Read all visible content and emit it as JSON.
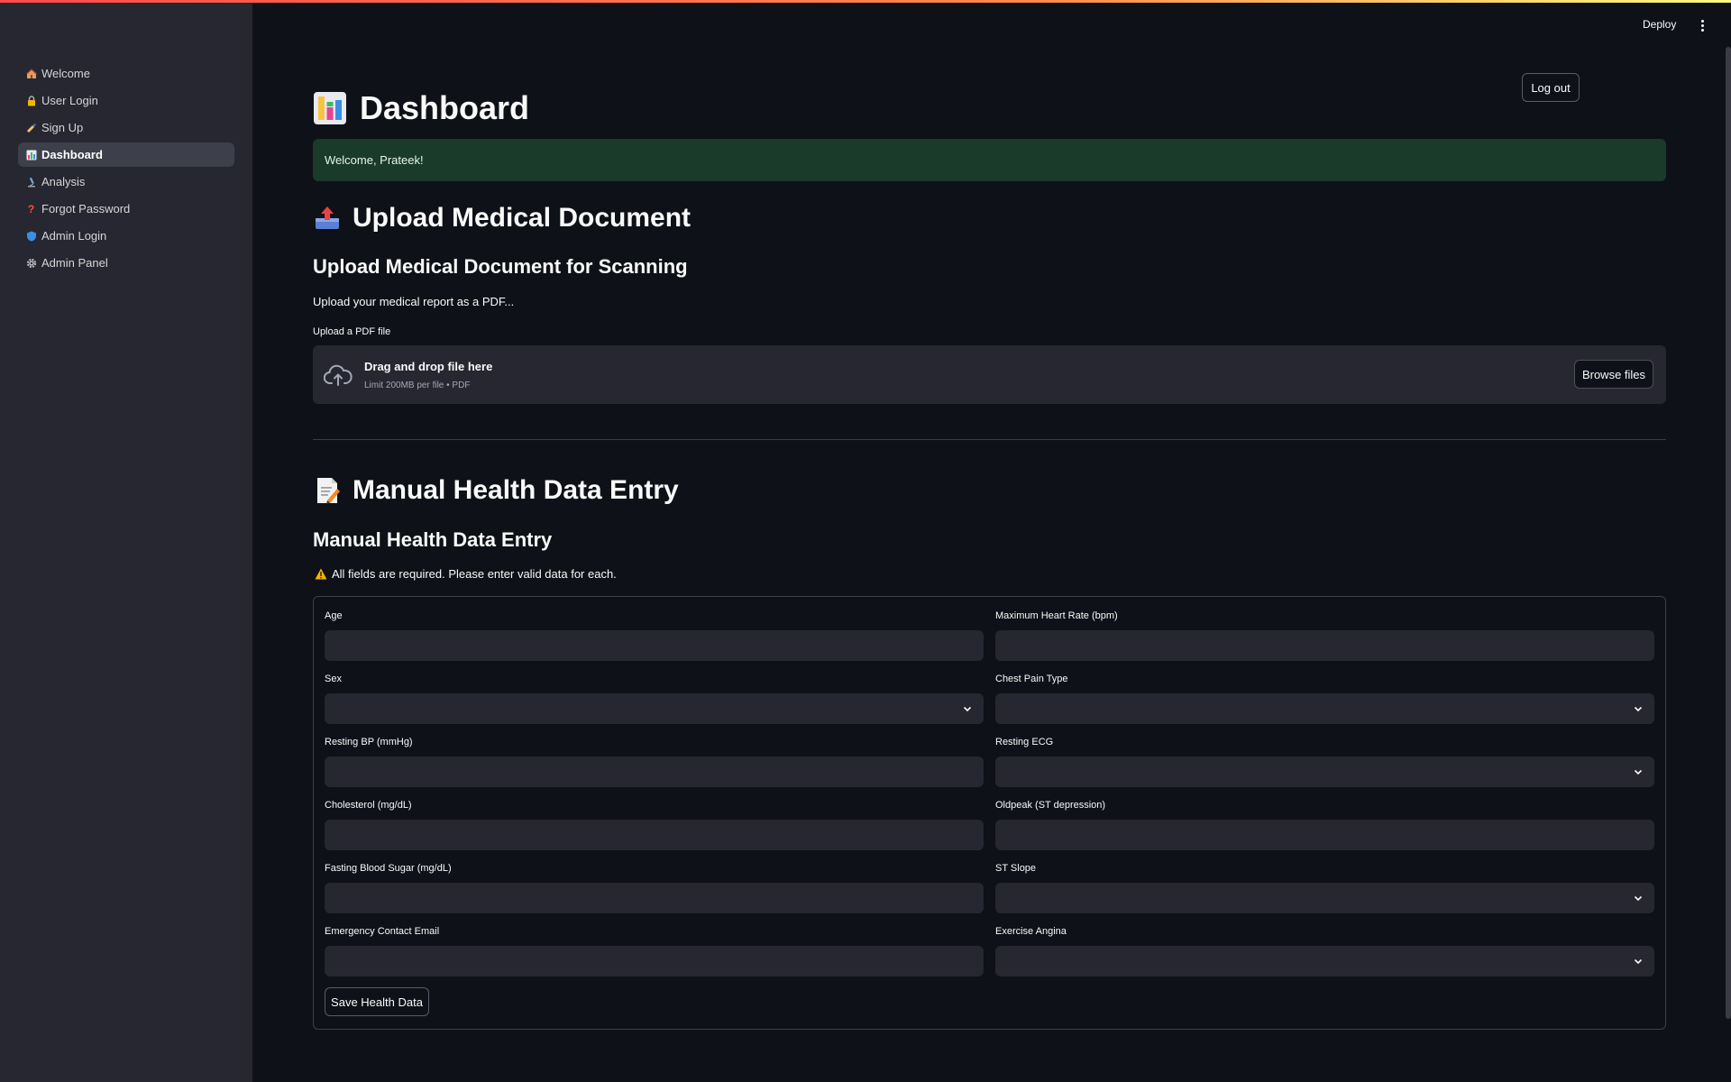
{
  "sidebar": {
    "items": [
      {
        "label": "Welcome",
        "icon": "house-icon",
        "active": false
      },
      {
        "label": "User Login",
        "icon": "lock-icon",
        "active": false
      },
      {
        "label": "Sign Up",
        "icon": "writing-hand-icon",
        "active": false
      },
      {
        "label": "Dashboard",
        "icon": "bar-chart-icon",
        "active": true
      },
      {
        "label": "Analysis",
        "icon": "microscope-icon",
        "active": false
      },
      {
        "label": "Forgot Password",
        "icon": "question-icon",
        "active": false
      },
      {
        "label": "Admin Login",
        "icon": "shield-icon",
        "active": false
      },
      {
        "label": "Admin Panel",
        "icon": "gear-icon",
        "active": false
      }
    ]
  },
  "header": {
    "deploy_label": "Deploy",
    "menu_icon": "kebab-menu-icon"
  },
  "main": {
    "logout_label": "Log out",
    "title": "Dashboard",
    "title_icon": "bar-chart-icon",
    "success_message": "Welcome, Prateek!",
    "upload_section": {
      "heading": "Upload Medical Document",
      "heading_icon": "outbox-tray-icon",
      "subheading": "Upload Medical Document for Scanning",
      "description": "Upload your medical report as a PDF...",
      "uploader_label": "Upload a PDF file",
      "drag_text": "Drag and drop file here",
      "limit_text": "Limit 200MB per file • PDF",
      "browse_label": "Browse files",
      "cloud_icon": "cloud-upload-icon"
    },
    "manual_section": {
      "heading": "Manual Health Data Entry",
      "heading_icon": "memo-icon",
      "subheading": "Manual Health Data Entry",
      "warning": "All fields are required. Please enter valid data for each.",
      "fields": {
        "age": {
          "label": "Age",
          "value": ""
        },
        "max_hr": {
          "label": "Maximum Heart Rate (bpm)",
          "value": ""
        },
        "sex": {
          "label": "Sex",
          "value": ""
        },
        "chest_pain": {
          "label": "Chest Pain Type",
          "value": ""
        },
        "resting_bp": {
          "label": "Resting BP (mmHg)",
          "value": ""
        },
        "resting_ecg": {
          "label": "Resting ECG",
          "value": ""
        },
        "cholesterol": {
          "label": "Cholesterol (mg/dL)",
          "value": ""
        },
        "oldpeak": {
          "label": "Oldpeak (ST depression)",
          "value": ""
        },
        "fbs": {
          "label": "Fasting Blood Sugar (mg/dL)",
          "value": ""
        },
        "st_slope": {
          "label": "ST Slope",
          "value": ""
        },
        "email": {
          "label": "Emergency Contact Email",
          "value": ""
        },
        "angina": {
          "label": "Exercise Angina",
          "value": ""
        }
      },
      "save_label": "Save Health Data"
    }
  },
  "colors": {
    "background": "#0e1117",
    "sidebar": "#262730",
    "input": "#262730",
    "success_bg": "#1a3a2a",
    "accent": "#ff4b4b"
  }
}
